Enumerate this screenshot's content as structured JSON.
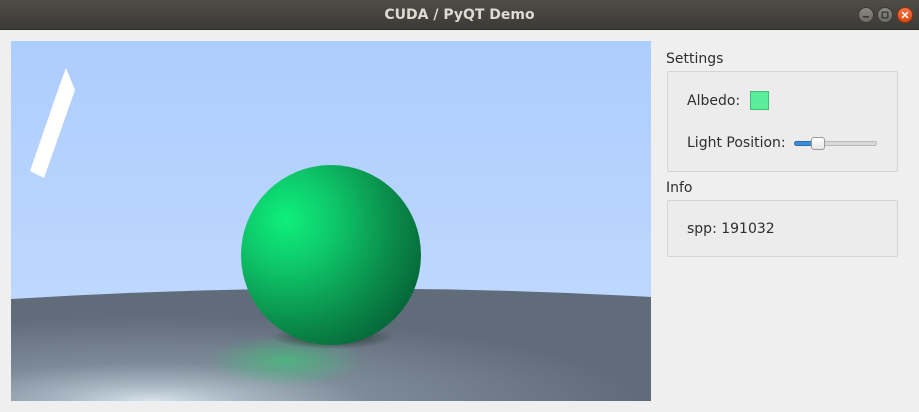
{
  "window": {
    "title": "CUDA / PyQT Demo",
    "controls": [
      "minimize",
      "maximize",
      "close"
    ]
  },
  "render_view": {
    "description_icon": "rendered-scene",
    "colors": {
      "sky_top": "#aecdfd",
      "sky_horizon": "#c2dafe",
      "floor": "#65707f",
      "sphere": "#12a85c",
      "sphere_highlight": "#00e676",
      "light_panel": "#ffffff"
    }
  },
  "settings": {
    "title": "Settings",
    "albedo_label": "Albedo:",
    "albedo_color": "#5aee9a",
    "light_position_label": "Light Position:",
    "light_position_value": 0.25
  },
  "info": {
    "title": "Info",
    "spp_text": "spp: 191032"
  }
}
